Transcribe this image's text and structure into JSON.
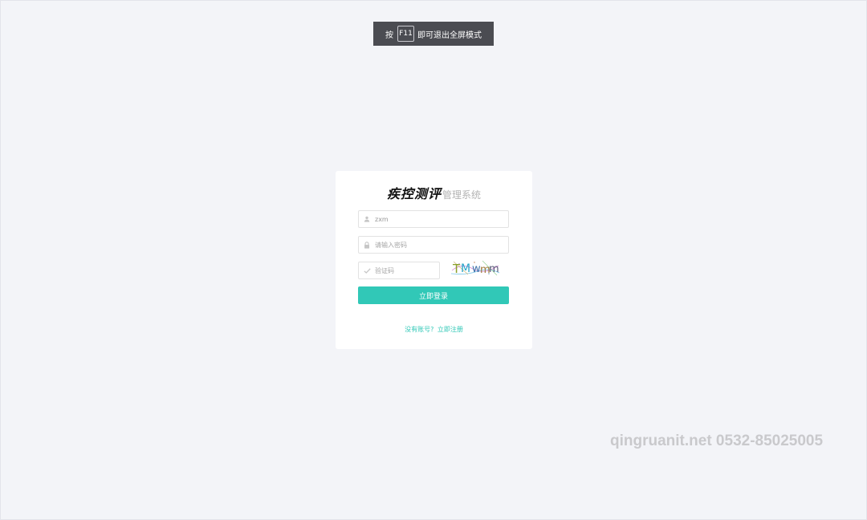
{
  "fullscreen_hint": {
    "prefix": "按",
    "key": "F11",
    "suffix": "即可退出全屏模式"
  },
  "login": {
    "brand_script": "疾控测评",
    "brand_sub": "管理系统",
    "username": {
      "value": "zxm",
      "icon": "user-icon"
    },
    "password": {
      "placeholder": "请输入密码",
      "icon": "lock-icon"
    },
    "captcha": {
      "placeholder": "验证码",
      "icon": "check-icon",
      "image_text": "TMwmm"
    },
    "submit_label": "立即登录",
    "register_prefix": "没有账号?",
    "register_link": "立即注册",
    "accent_color": "#31c8b7"
  },
  "watermark": "qingruanit.net 0532-85025005"
}
